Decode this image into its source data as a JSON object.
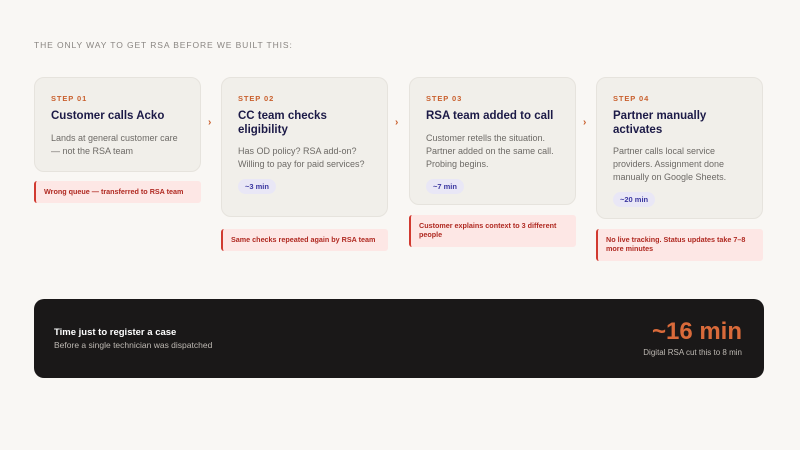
{
  "eyebrow": "THE ONLY WAY TO GET RSA BEFORE WE BUILT THIS:",
  "colors": {
    "accent": "#c9602e",
    "pain_border": "#d13a30",
    "badge_text": "#3b37a0",
    "summary_bg": "#1a1818"
  },
  "arrow_icon": "chevron-right-icon",
  "steps": [
    {
      "number": "STEP 01",
      "title": "Customer calls Acko",
      "description": "Lands at general customer care — not the RSA team",
      "pain": "Wrong queue — transferred to RSA team"
    },
    {
      "number": "STEP 02",
      "title": "CC team checks eligibility",
      "description": "Has OD policy? RSA add-on? Willing to pay for paid services?",
      "badge": "~3 min",
      "pain": "Same checks repeated again by RSA team"
    },
    {
      "number": "STEP 03",
      "title": "RSA team added to call",
      "description": "Customer retells the situation. Partner added on the same call. Probing begins.",
      "badge": "~7 min",
      "pain": "Customer explains context to 3 different people"
    },
    {
      "number": "STEP 04",
      "title": "Partner manually activates",
      "description": "Partner calls local service providers. Assignment done manually on Google Sheets.",
      "badge": "~20 min",
      "pain": "No live tracking. Status updates take 7–8 more minutes"
    }
  ],
  "summary": {
    "title": "Time just to register a case",
    "subtitle": "Before a single technician was dispatched",
    "value": "~16 min",
    "note": "Digital RSA cut this to 8 min"
  }
}
